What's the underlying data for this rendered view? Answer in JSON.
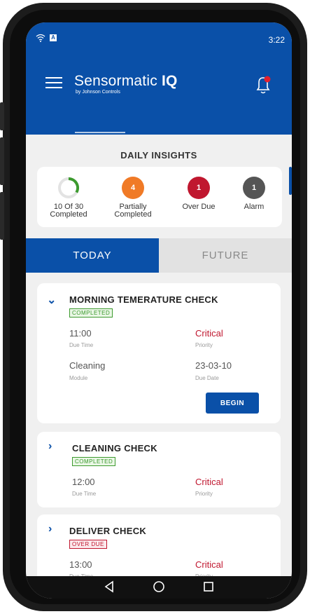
{
  "status_bar": {
    "time": "3:22",
    "icons": [
      "wifi-icon",
      "notification-a-icon"
    ]
  },
  "app_bar": {
    "brand_main": "Sensormatic",
    "brand_suffix": "IQ",
    "brand_sub": "by Johnson Controls",
    "menu_icon": "hamburger-icon",
    "notification_icon": "bell-icon",
    "notification_dot_color": "#e3202e"
  },
  "insights": {
    "title": "DAILY INSIGHTS",
    "items": [
      {
        "value": "",
        "label_line1": "10 Of 30",
        "label_line2": "Completed",
        "color": "#3c9a2e",
        "progress": 0.33
      },
      {
        "value": "4",
        "label_line1": "Partially",
        "label_line2": "Completed",
        "color": "#f07a26"
      },
      {
        "value": "1",
        "label_line1": "Over Due",
        "label_line2": "",
        "color": "#c0172f"
      },
      {
        "value": "1",
        "label_line1": "Alarm",
        "label_line2": "",
        "color": "#555555"
      }
    ]
  },
  "tabs": {
    "today": "TODAY",
    "future": "FUTURE",
    "selected": "today"
  },
  "tasks": [
    {
      "title": "MORNING TEMERATURE CHECK",
      "status": "COMPLETED",
      "due_time": "11:00",
      "due_time_label": "Due Time",
      "priority": "Critical",
      "priority_label": "Priority",
      "module": "Cleaning",
      "module_label": "Module",
      "due_date": "23-03-10",
      "due_date_label": "Due Date",
      "action": "BEGIN",
      "expanded": true
    },
    {
      "title": "CLEANING CHECK",
      "status": "COMPLETED",
      "due_time": "12:00",
      "due_time_label": "Due Time",
      "priority": "Critical",
      "priority_label": "Priority",
      "expanded": false
    },
    {
      "title": "DELIVER CHECK",
      "status": "OVER DUE",
      "due_time": "13:00",
      "due_time_label": "Due Time",
      "priority": "Critical",
      "priority_label": "Priority",
      "expanded": false
    }
  ],
  "colors": {
    "brand_blue": "#0a50a8",
    "critical_red": "#c0172f",
    "completed_green": "#3c9a2e"
  },
  "nav_bar": {
    "icons": [
      "back-icon",
      "home-icon",
      "recents-icon"
    ]
  }
}
